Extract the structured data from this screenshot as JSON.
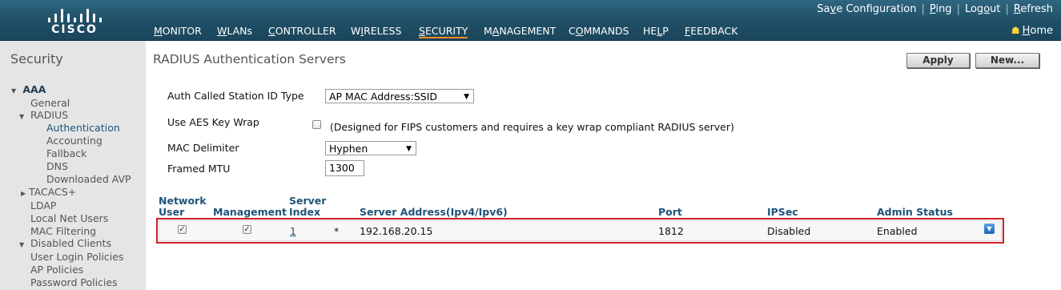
{
  "header": {
    "brand": "CISCO",
    "menu": [
      {
        "pre": "",
        "ul": "M",
        "post": "ONITOR"
      },
      {
        "pre": "",
        "ul": "W",
        "post": "LANs"
      },
      {
        "pre": "",
        "ul": "C",
        "post": "ONTROLLER"
      },
      {
        "pre": "W",
        "ul": "I",
        "post": "RELESS"
      },
      {
        "pre": "",
        "ul": "S",
        "post": "ECURITY"
      },
      {
        "pre": "M",
        "ul": "A",
        "post": "NAGEMENT"
      },
      {
        "pre": "C",
        "ul": "O",
        "post": "MMANDS"
      },
      {
        "pre": "HE",
        "ul": "L",
        "post": "P"
      },
      {
        "pre": "",
        "ul": "F",
        "post": "EEDBACK"
      }
    ],
    "links": {
      "save_pre": "Sa",
      "save_ul": "v",
      "save_post": "e Configuration",
      "ping_ul": "P",
      "ping_post": "ing",
      "logout_pre": "Log",
      "logout_ul": "o",
      "logout_post": "ut",
      "refresh_ul": "R",
      "refresh_post": "efresh",
      "home_ul": "H",
      "home_post": "ome"
    },
    "accent": "#ff8a1e"
  },
  "sidebar": {
    "title": "Security",
    "items": [
      "AAA",
      "General",
      "RADIUS",
      "Authentication",
      "Accounting",
      "Fallback",
      "DNS",
      "Downloaded AVP",
      "TACACS+",
      "LDAP",
      "Local Net Users",
      "MAC Filtering",
      "Disabled Clients",
      "User Login Policies",
      "AP Policies",
      "Password Policies"
    ]
  },
  "main": {
    "title": "RADIUS Authentication Servers",
    "apply_label": "Apply",
    "new_label": "New...",
    "form": {
      "auth_called_station_label": "Auth Called Station ID Type",
      "auth_called_station_value": "AP MAC Address:SSID",
      "aes_key_wrap_label": "Use AES Key Wrap",
      "aes_key_wrap_note": "(Designed for FIPS customers and requires a key wrap compliant RADIUS server)",
      "mac_delimiter_label": "MAC Delimiter",
      "mac_delimiter_value": "Hyphen",
      "framed_mtu_label": "Framed MTU",
      "framed_mtu_value": "1300"
    },
    "table": {
      "headers": {
        "network_user_1": "Network",
        "network_user_2": "User",
        "management": "Management",
        "server_index_1": "Server",
        "server_index_2": "Index",
        "server_address": "Server Address(Ipv4/Ipv6)",
        "port": "Port",
        "ipsec": "IPSec",
        "admin_status": "Admin Status"
      },
      "rows": [
        {
          "network_user": true,
          "management": true,
          "server_index": "1",
          "marker": "*",
          "server_address": "192.168.20.15",
          "port": "1812",
          "ipsec": "Disabled",
          "admin_status": "Enabled"
        }
      ]
    },
    "highlight_color": "#cc2128"
  }
}
